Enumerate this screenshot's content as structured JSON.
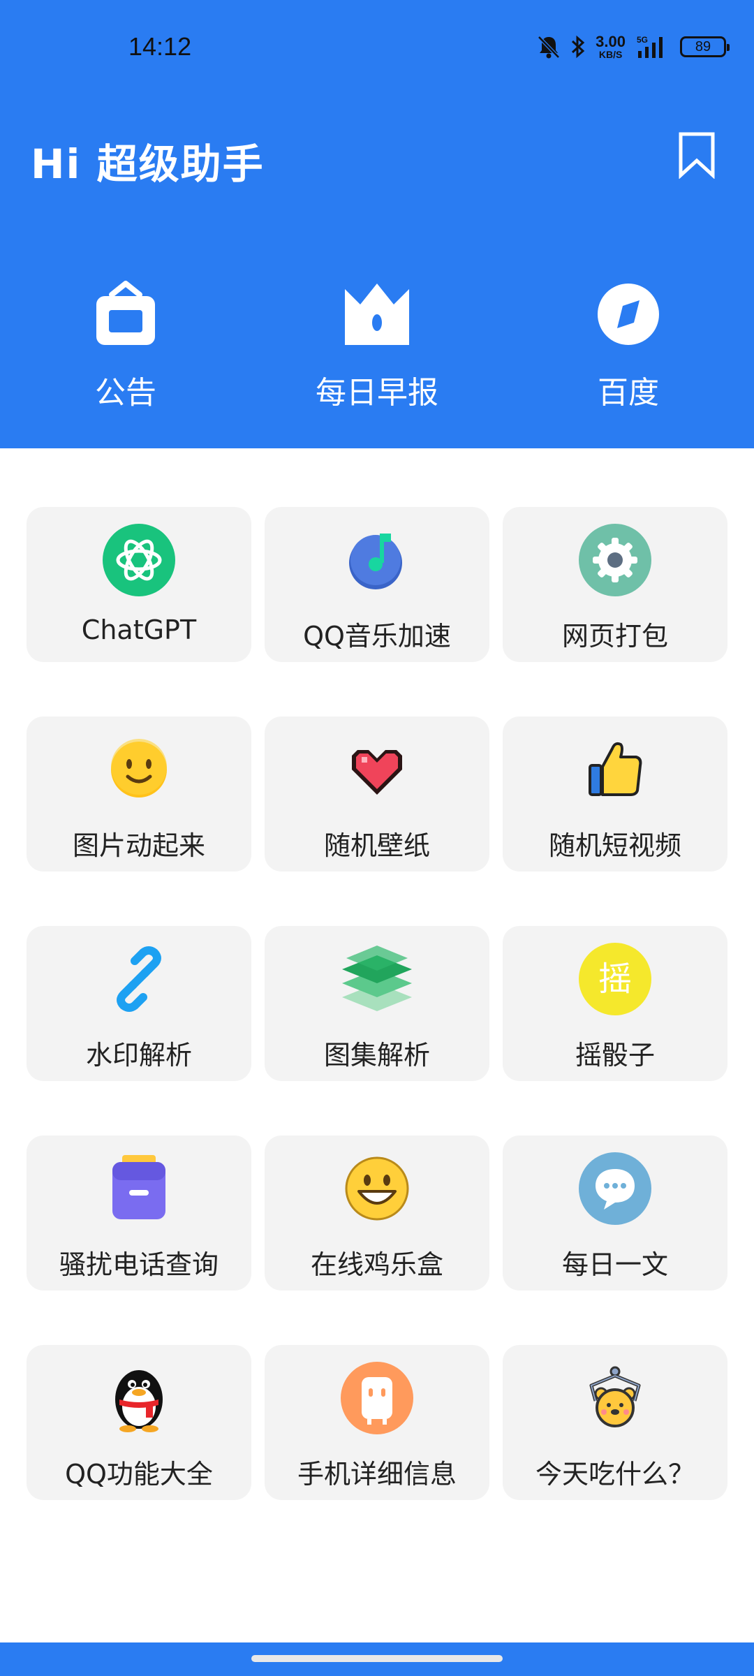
{
  "status_bar": {
    "time": "14:12",
    "speed_value": "3.00",
    "speed_unit": "KB/S",
    "network": "5G",
    "battery": "89"
  },
  "header": {
    "title": "Hi 超级助手",
    "accent_color": "#2a7cf2"
  },
  "top_actions": [
    {
      "label": "公告",
      "icon": "announcement-icon"
    },
    {
      "label": "每日早报",
      "icon": "crown-icon"
    },
    {
      "label": "百度",
      "icon": "compass-icon"
    }
  ],
  "tools": [
    {
      "label": "ChatGPT",
      "icon": "chatgpt-icon"
    },
    {
      "label": "QQ音乐加速",
      "icon": "music-note-icon"
    },
    {
      "label": "网页打包",
      "icon": "gear-icon"
    },
    {
      "label": "图片动起来",
      "icon": "smiley-icon"
    },
    {
      "label": "随机壁纸",
      "icon": "heart-icon"
    },
    {
      "label": "随机短视频",
      "icon": "thumbs-up-icon"
    },
    {
      "label": "水印解析",
      "icon": "link-icon"
    },
    {
      "label": "图集解析",
      "icon": "layers-icon"
    },
    {
      "label": "摇骰子",
      "icon": "shake-icon",
      "icon_text": "摇"
    },
    {
      "label": "骚扰电话查询",
      "icon": "folder-icon"
    },
    {
      "label": "在线鸡乐盒",
      "icon": "grinning-face-icon"
    },
    {
      "label": "每日一文",
      "icon": "chat-bubble-icon"
    },
    {
      "label": "QQ功能大全",
      "icon": "penguin-icon"
    },
    {
      "label": "手机详细信息",
      "icon": "phone-info-icon"
    },
    {
      "label": "今天吃什么？",
      "icon": "claw-machine-bear-icon"
    }
  ]
}
